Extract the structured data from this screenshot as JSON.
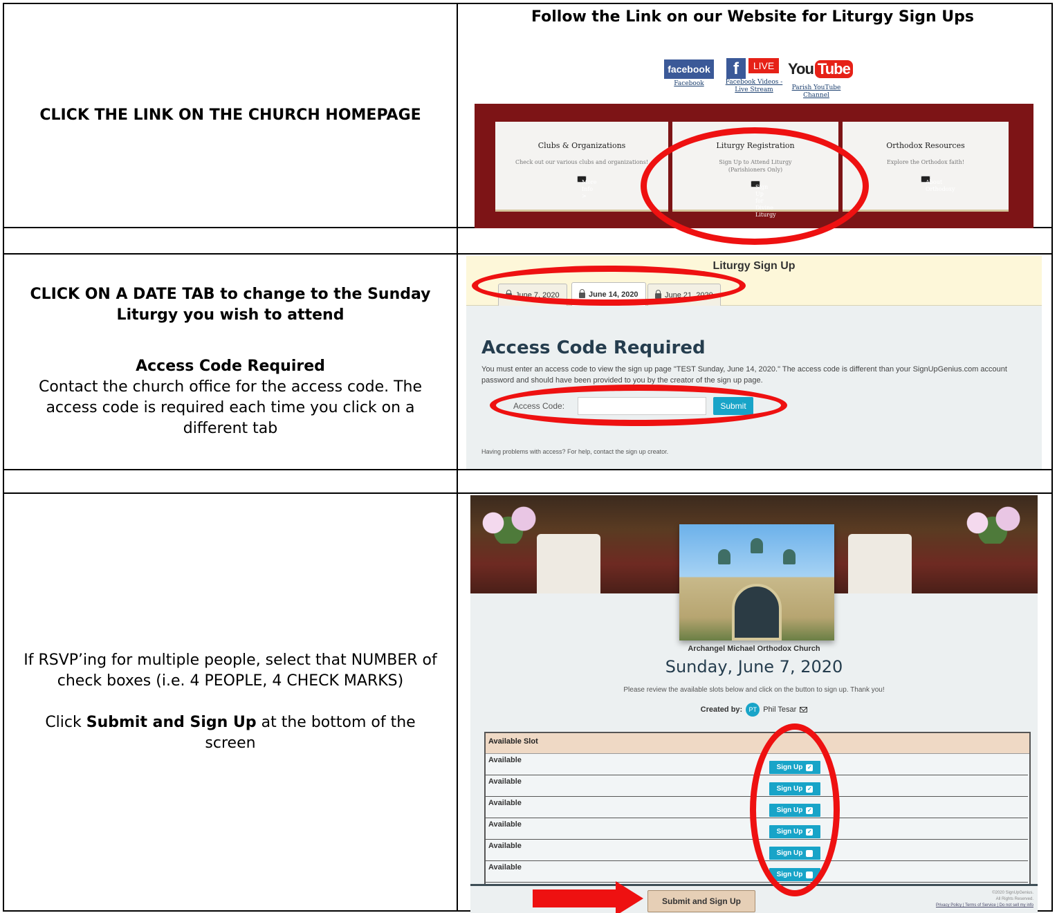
{
  "left": {
    "row1": "CLICK THE LINK ON THE CHURCH HOMEPAGE",
    "row2": {
      "line1": "CLICK ON A DATE TAB to change to the Sunday Liturgy you wish to attend",
      "heading": "Access Code Required",
      "line2": "Contact the church office for the access code.  The access code is required each time you click on a different tab"
    },
    "row3": {
      "line1": "If RSVP’ing for multiple people,  select that NUMBER of check boxes (i.e. 4 PEOPLE, 4 CHECK MARKS)",
      "click_prefix": "Click ",
      "click_bold": "Submit and Sign Up",
      "click_suffix": " at the bottom of the screen"
    }
  },
  "panel1": {
    "title": "Follow the Link on our Website for Liturgy Sign Ups",
    "social": {
      "facebook_logo": "facebook",
      "facebook_caption": "Facebook",
      "fb_f": "f",
      "live_logo": "LIVE",
      "live_caption_1": "Facebook Videos -",
      "live_caption_2": "Live Stream",
      "yt_you": "You",
      "yt_tube": "Tube",
      "yt_caption_1": "Parish YouTube",
      "yt_caption_2": "Channel"
    },
    "cards": [
      {
        "title": "Clubs & Organizations",
        "desc": "Check out our various clubs and organizations!",
        "button": "More Info >"
      },
      {
        "title": "Liturgy Registration",
        "desc": "Sign Up to Attend Liturgy (Parishioners Only)",
        "button": "Sign Up for Divine Liturgy"
      },
      {
        "title": "Orthodox Resources",
        "desc": "Explore the Orthodox faith!",
        "button": "About Orthodoxy"
      }
    ]
  },
  "panel2": {
    "title": "Liturgy Sign Up",
    "tabs": [
      "June 7, 2020",
      "June 14, 2020",
      "June 21, 2020"
    ],
    "heading": "Access Code Required",
    "description": "You must enter an access code to view the sign up page \"TEST Sunday, June 14, 2020.\" The access code is different than your SignUpGenius.com account password and should have been provided to you by the creator of the sign up page.",
    "access_label": "Access Code:",
    "submit": "Submit",
    "help": "Having problems with access? For help, contact the sign up creator."
  },
  "panel3": {
    "org": "Archangel Michael Orthodox Church",
    "date": "Sunday, June 7, 2020",
    "review": "Please review the available slots below and click on the button to sign up. Thank you!",
    "created_label": "Created by:",
    "avatar": "PT",
    "creator": "Phil Tesar",
    "slot_header": "Available Slot",
    "slot_label": "Available",
    "signup_label": "Sign Up",
    "slots_checked": [
      true,
      true,
      true,
      true,
      false,
      false
    ],
    "submit_big": "Submit and Sign Up",
    "legal_1": "©2020 SignUpGenius.",
    "legal_2": "All Rights Reserved.",
    "legal_links": "Privacy Policy | Terms of Service | Do not sell my info"
  },
  "colors": {
    "highlight_red": "#ee1111",
    "banner_maroon": "#7d1416",
    "signup_blue": "#18a4c8"
  }
}
